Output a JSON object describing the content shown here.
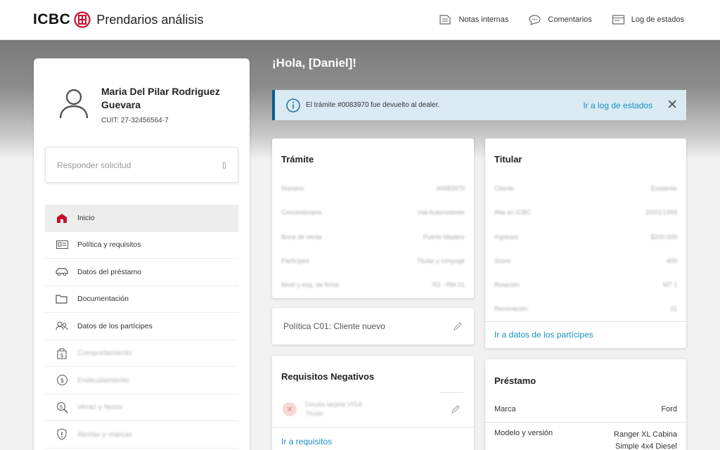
{
  "header": {
    "brand": "ICBC",
    "app_title": "Prendarios análisis",
    "actions": [
      {
        "label": "Notas internas",
        "icon": "notes-icon"
      },
      {
        "label": "Comentarios",
        "icon": "comments-icon"
      },
      {
        "label": "Log de estados",
        "icon": "log-icon"
      }
    ]
  },
  "sidebar": {
    "user": {
      "name": "Maria Del Pilar Rodriguez Guevara",
      "cuit": "CUIT: 27-32456564-7"
    },
    "reply_placeholder": "Responder solicitud",
    "reply_icon": "▯",
    "items": [
      {
        "label": "Inicio",
        "icon": "home-icon",
        "active": true
      },
      {
        "label": "Política y requisitos",
        "icon": "id-card-icon"
      },
      {
        "label": "Datos del préstamo",
        "icon": "car-icon"
      },
      {
        "label": "Documentación",
        "icon": "folder-icon"
      },
      {
        "label": "Datos de los partícipes",
        "icon": "people-icon"
      },
      {
        "label": "Comportamiento",
        "icon": "bag-icon"
      },
      {
        "label": "Endeudamiento",
        "icon": "debt-icon"
      },
      {
        "label": "Veraz y Nosis",
        "icon": "search-money-icon"
      },
      {
        "label": "Alertas y marcas",
        "icon": "shield-icon"
      }
    ]
  },
  "main": {
    "greeting": "¡Hola, [Daniel]!",
    "alert": {
      "text": "El trámite #0083970 fue devuelto al dealer.",
      "link": "Ir a log de estados",
      "close": "✕"
    },
    "tramite": {
      "title": "Trámite",
      "rows": [
        {
          "k": "Número",
          "v": "#0083970"
        },
        {
          "k": "Concesionaria",
          "v": "Vial Automotores"
        },
        {
          "k": "Boca de venta",
          "v": "Puerto Madero"
        },
        {
          "k": "Partícipes",
          "v": "Titular y cónyuge"
        },
        {
          "k": "Nivel y esq. de firma",
          "v": "R3 - RM 01"
        }
      ]
    },
    "titular": {
      "title": "Titular",
      "rows": [
        {
          "k": "Cliente",
          "v": "Existente"
        },
        {
          "k": "Alta en ICBC",
          "v": "20/01/1999"
        },
        {
          "k": "Ingresos",
          "v": "$200.000"
        },
        {
          "k": "Score",
          "v": "400"
        },
        {
          "k": "Rotación",
          "v": "M7 1"
        },
        {
          "k": "Renovación",
          "v": "01"
        }
      ],
      "link": "Ir a datos de los partícipes"
    },
    "policy": {
      "label": "Política C01: Cliente nuevo"
    },
    "requisitos": {
      "title": "Requisitos Negativos",
      "item_line1": "Deuda tarjeta VISA",
      "item_line2": "Titular",
      "link": "Ir a requisitos"
    },
    "prestamo": {
      "title": "Préstamo",
      "rows": [
        {
          "k": "Marca",
          "v": "Ford"
        },
        {
          "k": "Modelo y versión",
          "v": "Ranger XL Cabina Simple 4x4 Diesel"
        }
      ]
    }
  },
  "colors": {
    "brand_red": "#c8102e",
    "link_blue": "#1a8ec4",
    "alert_bg": "#d9eaf3",
    "alert_border": "#0a5e8f"
  }
}
